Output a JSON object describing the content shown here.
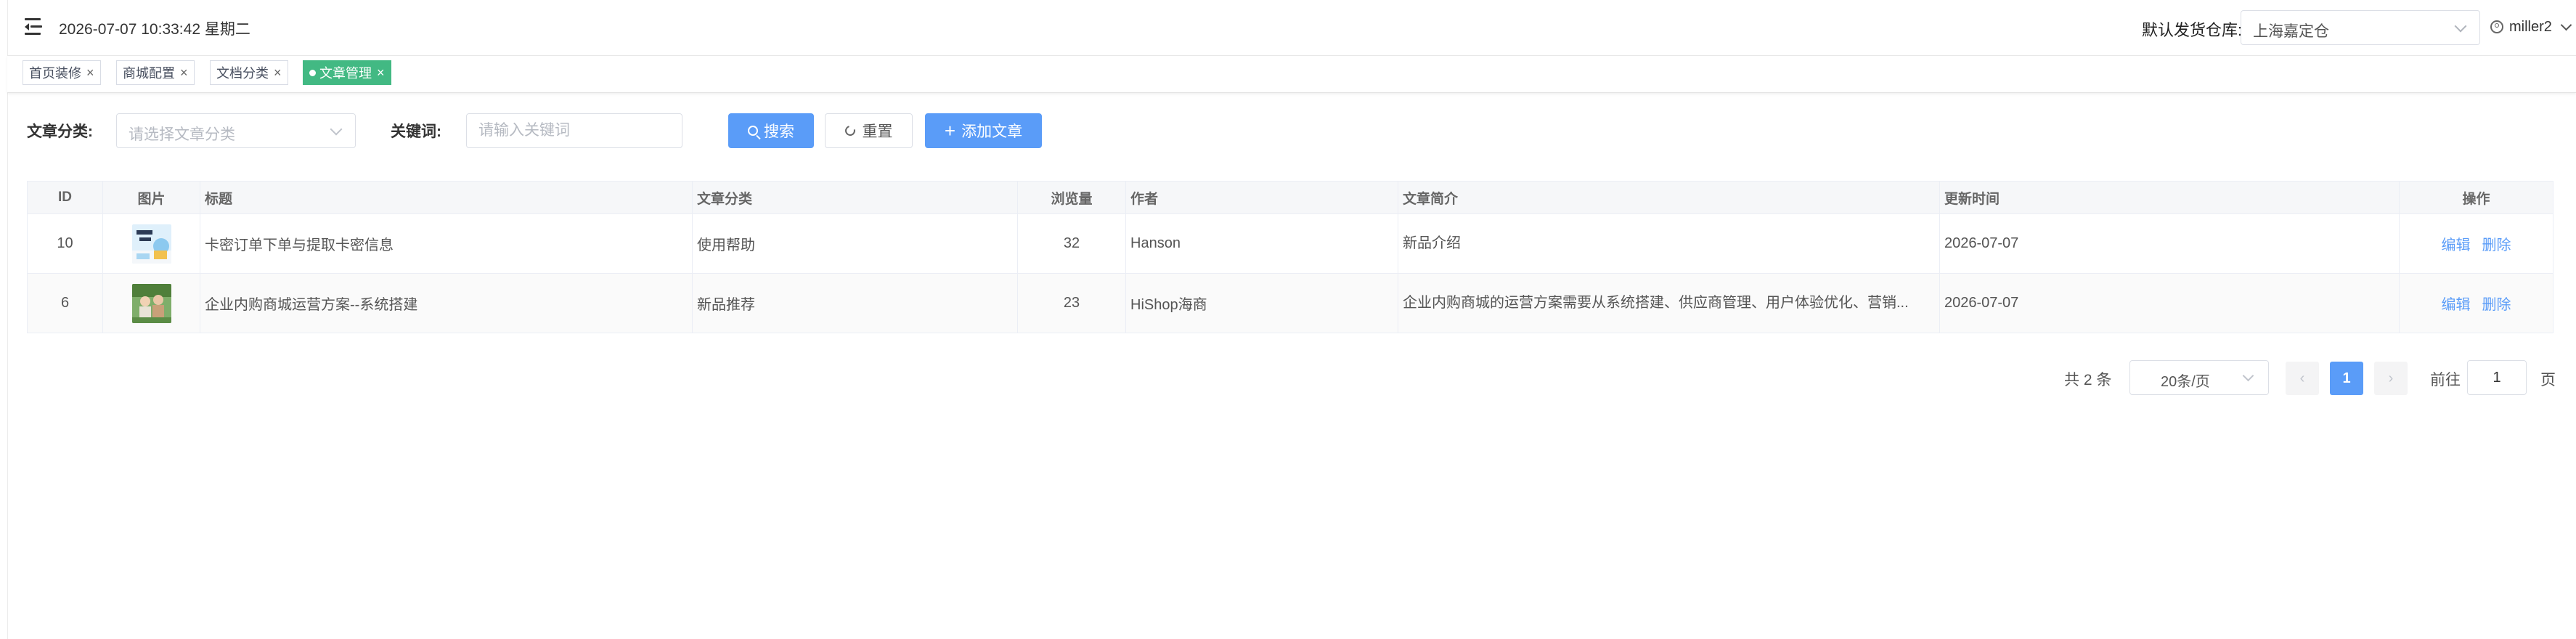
{
  "header": {
    "datetime": "2026-07-07 10:33:42 星期二",
    "warehouse_label": "默认发货仓库:",
    "warehouse_value": "上海嘉定仓",
    "user_name": "miller2"
  },
  "tags": [
    {
      "label": "首页装修",
      "active": false
    },
    {
      "label": "商城配置",
      "active": false
    },
    {
      "label": "文档分类",
      "active": false
    },
    {
      "label": "文章管理",
      "active": true
    }
  ],
  "tag_close": "×",
  "filter": {
    "category_label": "文章分类:",
    "category_placeholder": "请选择文章分类",
    "keyword_label": "关键词:",
    "keyword_placeholder": "请输入关键词",
    "search_button": "搜索",
    "reset_button": "重置",
    "add_button": "添加文章"
  },
  "table": {
    "columns": [
      "ID",
      "图片",
      "标题",
      "文章分类",
      "浏览量",
      "作者",
      "文章简介",
      "更新时间",
      "操作"
    ],
    "rows": [
      {
        "id": "10",
        "title": "卡密订单下单与提取卡密信息",
        "category": "使用帮助",
        "views": "32",
        "author": "Hanson",
        "summary": "新品介绍",
        "updated": "2026-07-07",
        "edit": "编辑",
        "delete": "删除"
      },
      {
        "id": "6",
        "title": "企业内购商城运营方案--系统搭建",
        "category": "新品推荐",
        "views": "23",
        "author": "HiShop海商",
        "summary": "企业内购商城的运营方案需要从系统搭建、供应商管理、用户体验优化、营销...",
        "updated": "2026-07-07",
        "edit": "编辑",
        "delete": "删除"
      }
    ]
  },
  "pagination": {
    "total_text": "共 2 条",
    "page_size": "20条/页",
    "prev": "‹",
    "current_page": "1",
    "next": "›",
    "goto_label": "前往",
    "goto_value": "1",
    "goto_unit": "页"
  },
  "colors": {
    "primary": "#5a9cf8",
    "active_tag": "#42b983",
    "border": "#dcdfe6"
  },
  "icons": [
    "menu-toggle-icon",
    "user-icon",
    "chevron-down-icon",
    "close-icon",
    "search-icon",
    "refresh-icon",
    "plus-icon"
  ]
}
